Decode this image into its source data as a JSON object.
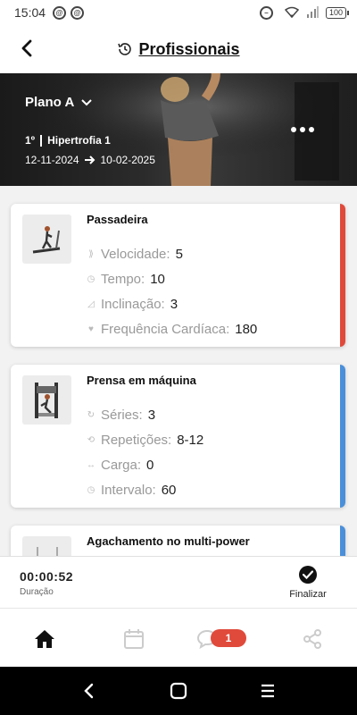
{
  "status_bar": {
    "time": "15:04",
    "battery": "100"
  },
  "header": {
    "title": "Profissionais"
  },
  "plan": {
    "name": "Plano A",
    "phase_number": "1º",
    "phase_name": "Hipertrofia 1",
    "start_date": "12-11-2024",
    "end_date": "10-02-2025"
  },
  "exercises": [
    {
      "name": "Passadeira",
      "accent": "#e04a3b",
      "params": [
        {
          "label": "Velocidade:",
          "value": "5",
          "icon": "speed-icon"
        },
        {
          "label": "Tempo:",
          "value": "10",
          "icon": "clock-icon"
        },
        {
          "label": "Inclinação:",
          "value": "3",
          "icon": "incline-icon"
        },
        {
          "label": "Frequência Cardíaca:",
          "value": "180",
          "icon": "heart-icon"
        }
      ]
    },
    {
      "name": "Prensa em máquina",
      "accent": "#4a8fd9",
      "params": [
        {
          "label": "Séries:",
          "value": "3",
          "icon": "repeat-icon"
        },
        {
          "label": "Repetições:",
          "value": "8-12",
          "icon": "cycle-icon"
        },
        {
          "label": "Carga:",
          "value": "0",
          "icon": "dumbbell-icon"
        },
        {
          "label": "Intervalo:",
          "value": "60",
          "icon": "clock-icon"
        }
      ]
    },
    {
      "name": "Agachamento no multi-power",
      "accent": "#4a8fd9",
      "params": []
    }
  ],
  "timer": {
    "value": "00:00:52",
    "label": "Duração"
  },
  "finish": {
    "label": "Finalizar"
  },
  "nav": {
    "notification_count": "1"
  },
  "colors": {
    "red_accent": "#e04a3b",
    "blue_accent": "#4a8fd9",
    "badge": "#e04a3b"
  }
}
